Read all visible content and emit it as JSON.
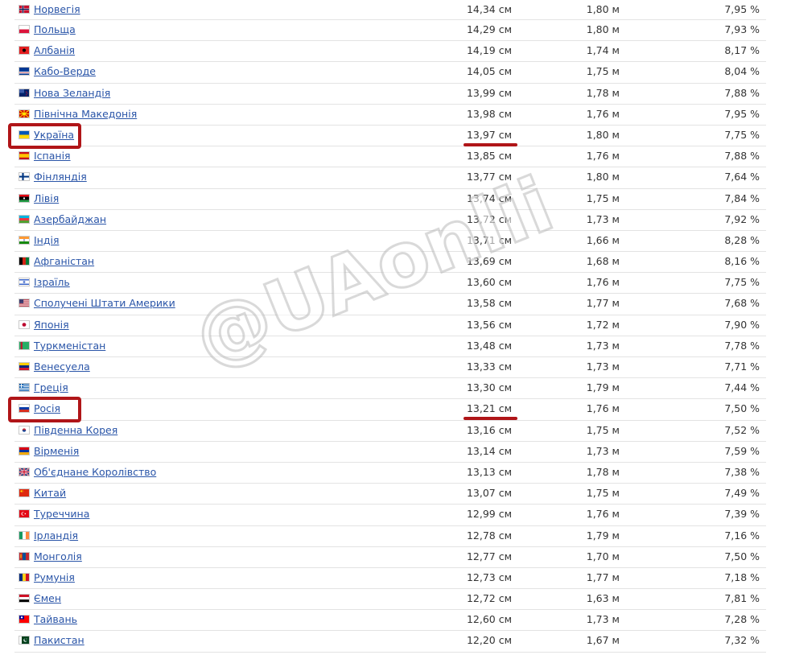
{
  "watermark": "@UAonlii",
  "rows": [
    {
      "country": "Норвегія",
      "c1": "14,34 см",
      "c2": "1,80 м",
      "c3": "7,95 %",
      "flag": "norway-flag-icon"
    },
    {
      "country": "Польща",
      "c1": "14,29 см",
      "c2": "1,80 м",
      "c3": "7,93 %",
      "flag": "poland-flag-icon"
    },
    {
      "country": "Албанія",
      "c1": "14,19 см",
      "c2": "1,74 м",
      "c3": "8,17 %",
      "flag": "albania-flag-icon"
    },
    {
      "country": "Кабо-Верде",
      "c1": "14,05 см",
      "c2": "1,75 м",
      "c3": "8,04 %",
      "flag": "cabo-verde-flag-icon"
    },
    {
      "country": "Нова Зеландія",
      "c1": "13,99 см",
      "c2": "1,78 м",
      "c3": "7,88 %",
      "flag": "new-zealand-flag-icon"
    },
    {
      "country": "Північна Македонія",
      "c1": "13,98 см",
      "c2": "1,76 м",
      "c3": "7,95 %",
      "flag": "north-macedonia-flag-icon"
    },
    {
      "country": "Україна",
      "c1": "13,97 см",
      "c2": "1,80 м",
      "c3": "7,75 %",
      "flag": "ukraine-flag-icon",
      "highlight": true
    },
    {
      "country": "Іспанія",
      "c1": "13,85 см",
      "c2": "1,76 м",
      "c3": "7,88 %",
      "flag": "spain-flag-icon"
    },
    {
      "country": "Фінляндія",
      "c1": "13,77 см",
      "c2": "1,80 м",
      "c3": "7,64 %",
      "flag": "finland-flag-icon"
    },
    {
      "country": "Лівія",
      "c1": "13,74 см",
      "c2": "1,75 м",
      "c3": "7,84 %",
      "flag": "libya-flag-icon"
    },
    {
      "country": "Азербайджан",
      "c1": "13,72 см",
      "c2": "1,73 м",
      "c3": "7,92 %",
      "flag": "azerbaijan-flag-icon"
    },
    {
      "country": "Індія",
      "c1": "13,71 см",
      "c2": "1,66 м",
      "c3": "8,28 %",
      "flag": "india-flag-icon"
    },
    {
      "country": "Афганістан",
      "c1": "13,69 см",
      "c2": "1,68 м",
      "c3": "8,16 %",
      "flag": "afghanistan-flag-icon"
    },
    {
      "country": "Ізраїль",
      "c1": "13,60 см",
      "c2": "1,76 м",
      "c3": "7,75 %",
      "flag": "israel-flag-icon"
    },
    {
      "country": "Сполучені Штати Америки",
      "c1": "13,58 см",
      "c2": "1,77 м",
      "c3": "7,68 %",
      "flag": "usa-flag-icon"
    },
    {
      "country": "Японія",
      "c1": "13,56 см",
      "c2": "1,72 м",
      "c3": "7,90 %",
      "flag": "japan-flag-icon"
    },
    {
      "country": "Туркменістан",
      "c1": "13,48 см",
      "c2": "1,73 м",
      "c3": "7,78 %",
      "flag": "turkmenistan-flag-icon"
    },
    {
      "country": "Венесуела",
      "c1": "13,33 см",
      "c2": "1,73 м",
      "c3": "7,71 %",
      "flag": "venezuela-flag-icon"
    },
    {
      "country": "Греція",
      "c1": "13,30 см",
      "c2": "1,79 м",
      "c3": "7,44 %",
      "flag": "greece-flag-icon"
    },
    {
      "country": "Росія",
      "c1": "13,21 см",
      "c2": "1,76 м",
      "c3": "7,50 %",
      "flag": "russia-flag-icon",
      "highlight": true
    },
    {
      "country": "Південна Корея",
      "c1": "13,16 см",
      "c2": "1,75 м",
      "c3": "7,52 %",
      "flag": "south-korea-flag-icon"
    },
    {
      "country": "Вірменія",
      "c1": "13,14 см",
      "c2": "1,73 м",
      "c3": "7,59 %",
      "flag": "armenia-flag-icon"
    },
    {
      "country": "Об'єднане Королівство",
      "c1": "13,13 см",
      "c2": "1,78 м",
      "c3": "7,38 %",
      "flag": "uk-flag-icon"
    },
    {
      "country": "Китай",
      "c1": "13,07 см",
      "c2": "1,75 м",
      "c3": "7,49 %",
      "flag": "china-flag-icon"
    },
    {
      "country": "Туреччина",
      "c1": "12,99 см",
      "c2": "1,76 м",
      "c3": "7,39 %",
      "flag": "turkey-flag-icon"
    },
    {
      "country": "Ірландія",
      "c1": "12,78 см",
      "c2": "1,79 м",
      "c3": "7,16 %",
      "flag": "ireland-flag-icon"
    },
    {
      "country": "Монголія",
      "c1": "12,77 см",
      "c2": "1,70 м",
      "c3": "7,50 %",
      "flag": "mongolia-flag-icon"
    },
    {
      "country": "Румунія",
      "c1": "12,73 см",
      "c2": "1,77 м",
      "c3": "7,18 %",
      "flag": "romania-flag-icon"
    },
    {
      "country": "Ємен",
      "c1": "12,72 см",
      "c2": "1,63 м",
      "c3": "7,81 %",
      "flag": "yemen-flag-icon"
    },
    {
      "country": "Тайвань",
      "c1": "12,60 см",
      "c2": "1,73 м",
      "c3": "7,28 %",
      "flag": "taiwan-flag-icon"
    },
    {
      "country": "Пакистан",
      "c1": "12,20 см",
      "c2": "1,67 м",
      "c3": "7,32 %",
      "flag": "pakistan-flag-icon"
    }
  ],
  "colors": {
    "link": "#2a55a8",
    "highlight": "#b01518",
    "text": "#333333"
  }
}
